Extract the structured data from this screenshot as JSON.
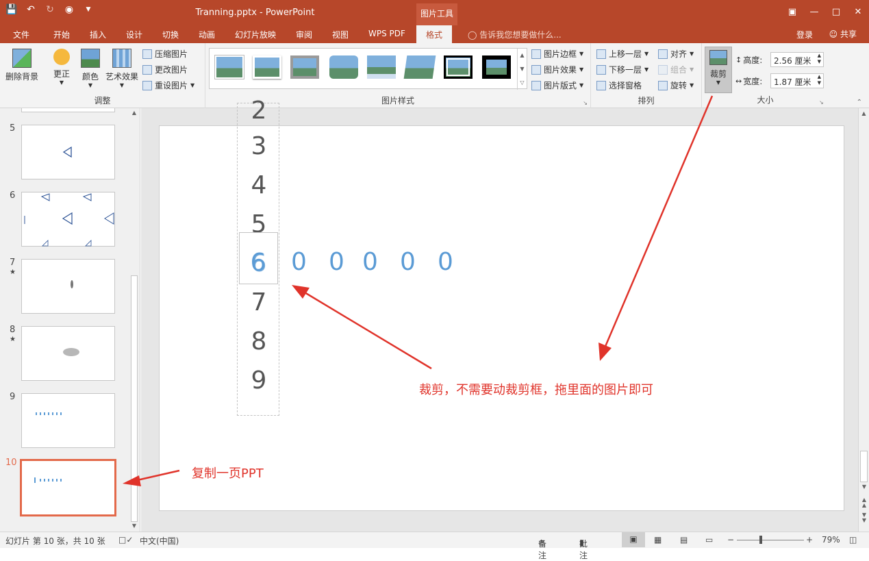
{
  "window": {
    "title": "Tranning.pptx - PowerPoint",
    "context_tab_header": "图片工具"
  },
  "tabs": [
    "文件",
    "开始",
    "插入",
    "设计",
    "切换",
    "动画",
    "幻灯片放映",
    "审阅",
    "视图",
    "WPS PDF",
    "格式"
  ],
  "tell_me": "告诉我您想要做什么...",
  "account": {
    "login": "登录",
    "share": "共享"
  },
  "ribbon": {
    "adjust": {
      "remove_bg": "删除背景",
      "corrections": "更正",
      "color": "颜色",
      "artistic": "艺术效果",
      "compress": "压缩图片",
      "change": "更改图片",
      "reset": "重设图片",
      "group_label": "调整"
    },
    "styles": {
      "border": "图片边框",
      "effects": "图片效果",
      "layout": "图片版式",
      "group_label": "图片样式"
    },
    "arrange": {
      "bring_forward": "上移一层",
      "send_backward": "下移一层",
      "selection_pane": "选择窗格",
      "align": "对齐",
      "group": "组合",
      "rotate": "旋转",
      "group_label": "排列"
    },
    "size": {
      "crop": "裁剪",
      "height_label": "高度:",
      "height_value": "2.56 厘米",
      "width_label": "宽度:",
      "width_value": "1.87 厘米",
      "group_label": "大小"
    }
  },
  "slides": [
    {
      "number": "5",
      "star": ""
    },
    {
      "number": "6",
      "star": ""
    },
    {
      "number": "7",
      "star": "★"
    },
    {
      "number": "8",
      "star": "★"
    },
    {
      "number": "9",
      "star": ""
    },
    {
      "number": "10",
      "star": ""
    }
  ],
  "slide_content": {
    "column_digits": [
      "2",
      "3",
      "4",
      "5",
      "6",
      "7",
      "8",
      "9"
    ],
    "zeros": [
      "0",
      "0",
      "0",
      "0",
      "0"
    ]
  },
  "annotations": {
    "crop_note": "裁剪，不需要动裁剪框，拖里面的图片即可",
    "copy_note": "复制一页PPT"
  },
  "status": {
    "slide_info": "幻灯片 第 10 张，共 10 张",
    "language": "中文(中国)",
    "notes": "备注",
    "comments": "批注",
    "zoom": "79%"
  },
  "colors": {
    "brand": "#b7472a",
    "accent_blue": "#5b9bd5",
    "annotation_red": "#e0332a",
    "selection": "#e3694a"
  }
}
